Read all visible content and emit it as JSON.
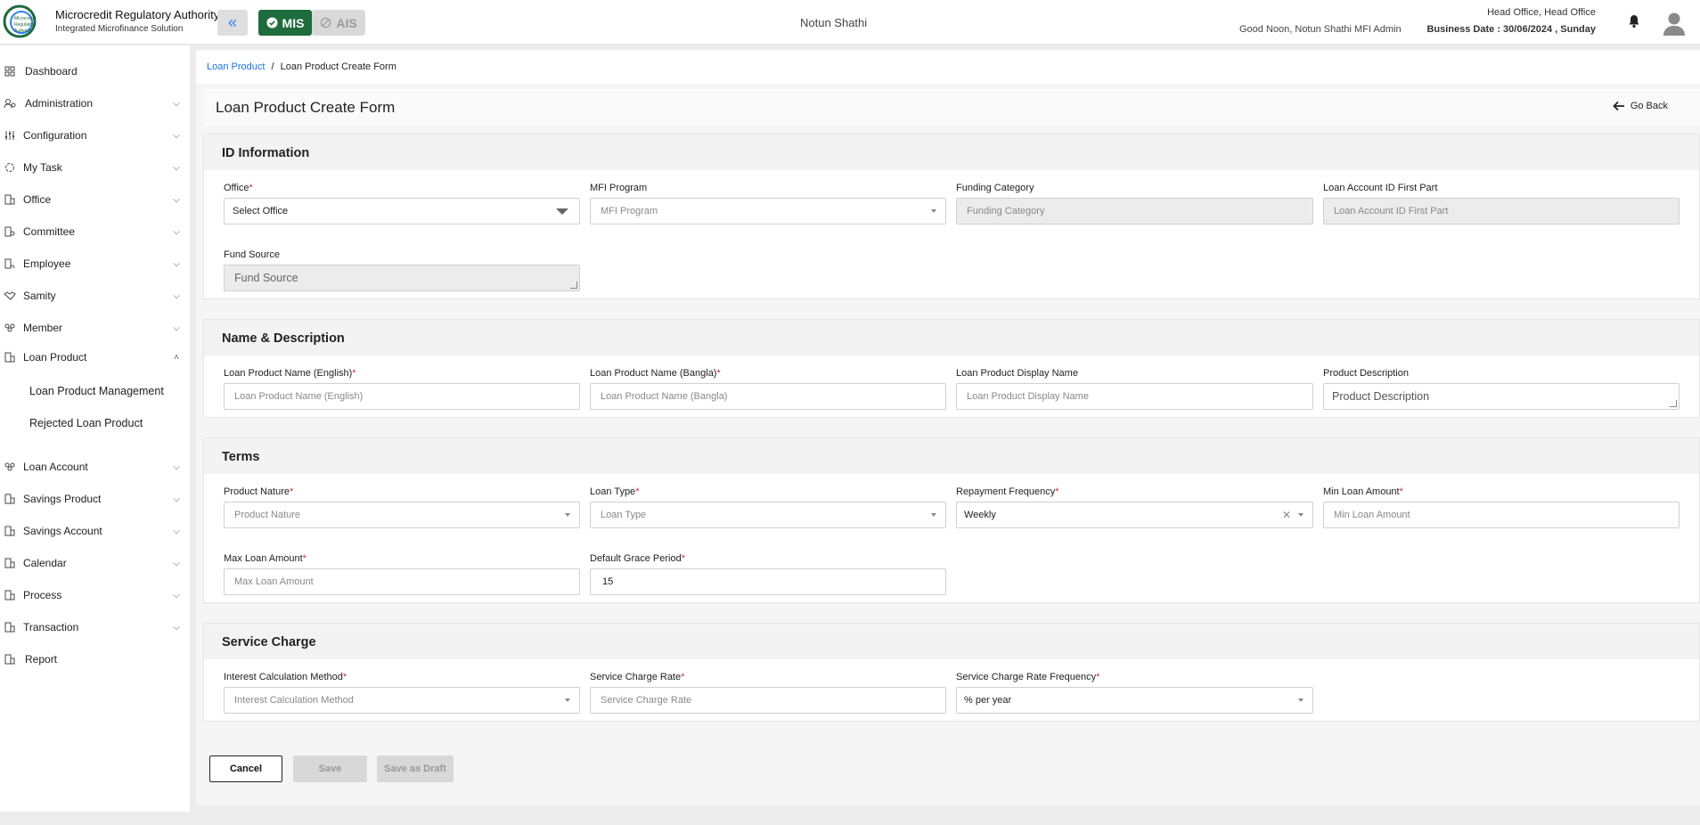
{
  "header": {
    "org_title": "Microcredit Regulatory Authority",
    "org_subtitle": "Integrated Microfinance Solution",
    "logo_text": "Microcredit Regulatory Authority",
    "mis_label": "MIS",
    "ais_label": "AIS",
    "center_org": "Notun Shathi",
    "greeting": "Good Noon, Notun Shathi MFI Admin",
    "office": "Head Office, Head Office",
    "business_date": "Business Date : 30/06/2024 , Sunday",
    "accent_color": "#1e6b3c",
    "link_color": "#1a73e8"
  },
  "sidebar": {
    "items": [
      {
        "label": "Dashboard",
        "icon": "grid-icon",
        "expandable": false
      },
      {
        "label": "Administration",
        "icon": "admin-icon",
        "expandable": true
      },
      {
        "label": "Configuration",
        "icon": "sliders-icon",
        "expandable": true
      },
      {
        "label": "My Task",
        "icon": "task-icon",
        "expandable": true
      },
      {
        "label": "Office",
        "icon": "building-icon",
        "expandable": true
      },
      {
        "label": "Committee",
        "icon": "committee-icon",
        "expandable": true
      },
      {
        "label": "Employee",
        "icon": "employee-icon",
        "expandable": true
      },
      {
        "label": "Samity",
        "icon": "handshake-icon",
        "expandable": true
      },
      {
        "label": "Member",
        "icon": "members-icon",
        "expandable": true
      },
      {
        "label": "Loan Product",
        "icon": "building-icon",
        "expandable": true,
        "expanded": true
      },
      {
        "label": "Loan Account",
        "icon": "members-icon",
        "expandable": true
      },
      {
        "label": "Savings Product",
        "icon": "building-icon",
        "expandable": true
      },
      {
        "label": "Savings Account",
        "icon": "building-icon",
        "expandable": true
      },
      {
        "label": "Calendar",
        "icon": "building-icon",
        "expandable": true
      },
      {
        "label": "Process",
        "icon": "building-icon",
        "expandable": true
      },
      {
        "label": "Transaction",
        "icon": "building-icon",
        "expandable": true
      },
      {
        "label": "Report",
        "icon": "building-icon",
        "expandable": false
      }
    ],
    "sub_items": [
      "Loan Product Management",
      "Rejected Loan Product"
    ]
  },
  "breadcrumb": {
    "parent": "Loan Product",
    "separator": "/",
    "current": "Loan Product Create Form"
  },
  "page": {
    "title": "Loan Product Create Form",
    "go_back": "Go Back"
  },
  "sections": {
    "id_info": {
      "title": "ID Information",
      "office_label": "Office",
      "office_value": "Select Office",
      "mfi_label": "MFI Program",
      "mfi_placeholder": "MFI Program",
      "funding_label": "Funding Category",
      "funding_placeholder": "Funding Category",
      "loan_acc_label": "Loan Account ID First Part",
      "loan_acc_placeholder": "Loan Account ID First Part",
      "fund_source_label": "Fund Source",
      "fund_source_placeholder": "Fund Source"
    },
    "name_desc": {
      "title": "Name & Description",
      "name_en_label": "Loan Product Name (English)",
      "name_en_placeholder": "Loan Product Name (English)",
      "name_bn_label": "Loan Product Name (Bangla)",
      "name_bn_placeholder": "Loan Product Name (Bangla)",
      "display_label": "Loan Product Display Name",
      "display_placeholder": "Loan Product Display Name",
      "desc_label": "Product Description",
      "desc_placeholder": "Product Description"
    },
    "terms": {
      "title": "Terms",
      "nature_label": "Product Nature",
      "nature_placeholder": "Product Nature",
      "type_label": "Loan Type",
      "type_placeholder": "Loan Type",
      "freq_label": "Repayment Frequency",
      "freq_value": "Weekly",
      "min_label": "Min Loan Amount",
      "min_placeholder": "Min Loan Amount",
      "max_label": "Max Loan Amount",
      "max_placeholder": "Max Loan Amount",
      "grace_label": "Default Grace Period",
      "grace_value": "15"
    },
    "service": {
      "title": "Service Charge",
      "method_label": "Interest Calculation Method",
      "method_placeholder": "Interest Calculation Method",
      "rate_label": "Service Charge Rate",
      "rate_placeholder": "Service Charge Rate",
      "rate_freq_label": "Service Charge Rate Frequency",
      "rate_freq_value": "% per year"
    }
  },
  "actions": {
    "cancel": "Cancel",
    "save": "Save",
    "save_draft": "Save as Draft"
  }
}
